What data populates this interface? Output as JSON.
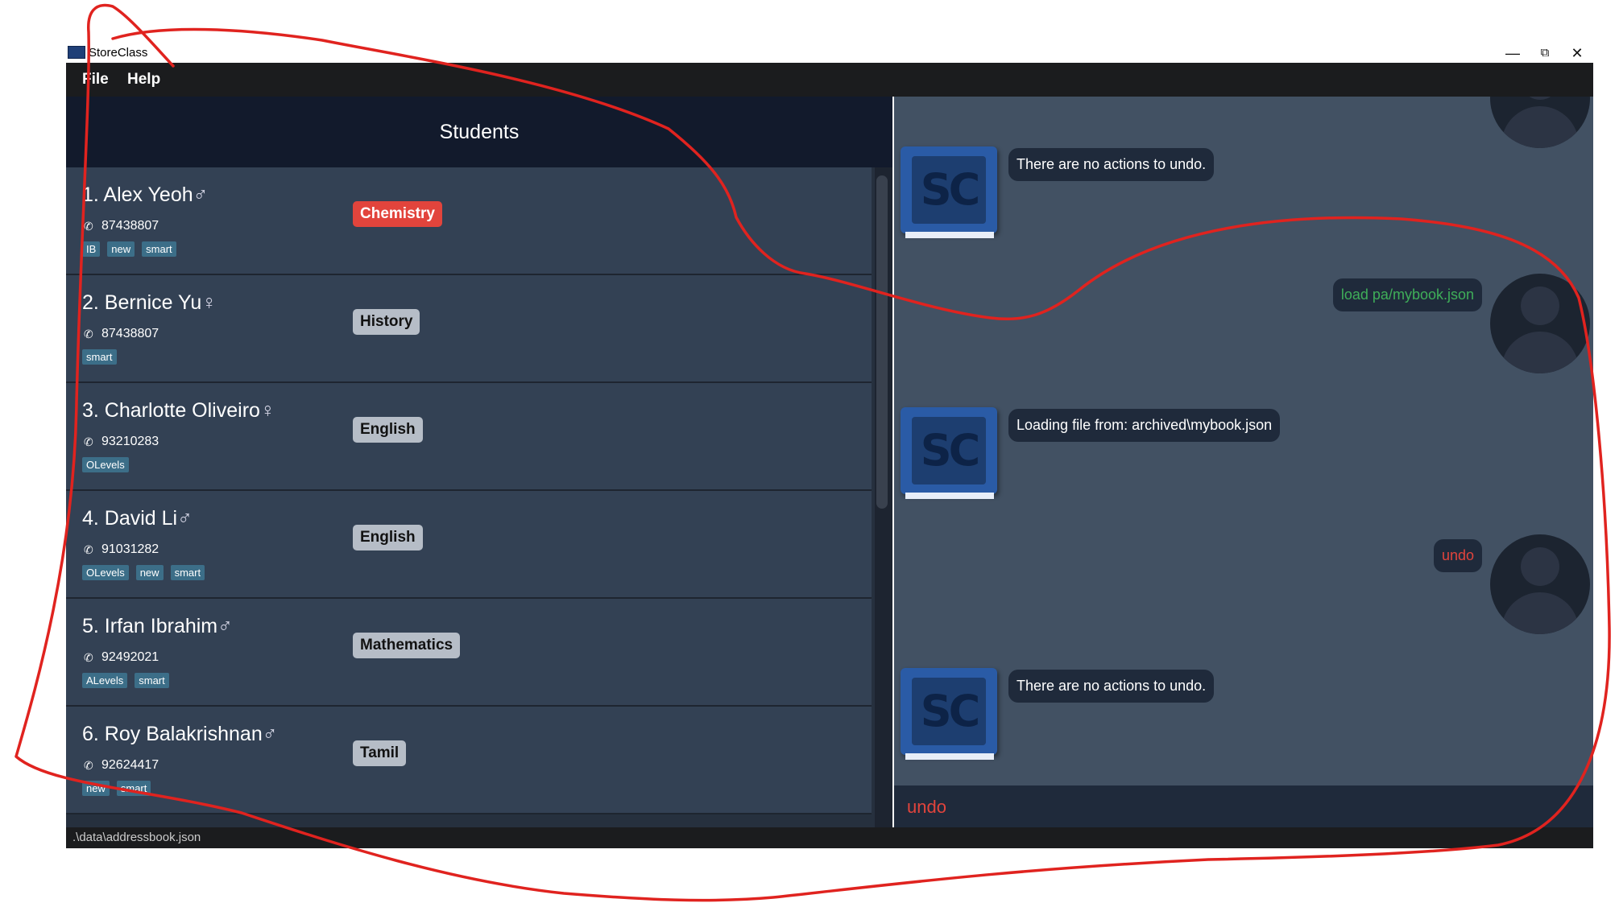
{
  "window": {
    "title": "StoreClass",
    "minimize_glyph": "—",
    "restore_glyph": "⧉",
    "close_glyph": "✕"
  },
  "menu": {
    "file": "File",
    "help": "Help"
  },
  "students_panel": {
    "title": "Students",
    "phone_icon": "phone-icon",
    "students": [
      {
        "name": "1. Alex Yeoh",
        "gender": "♂",
        "phone": "87438807",
        "tags": [
          "IB",
          "new",
          "smart"
        ],
        "subject": "Chemistry",
        "subject_color": "#e2443c"
      },
      {
        "name": "2. Bernice Yu",
        "gender": "♀",
        "phone": "87438807",
        "tags": [
          "smart"
        ],
        "subject": "History",
        "subject_color": "#b6bdc7"
      },
      {
        "name": "3. Charlotte Oliveiro",
        "gender": "♀",
        "phone": "93210283",
        "tags": [
          "OLevels"
        ],
        "subject": "English",
        "subject_color": "#b6bdc7"
      },
      {
        "name": "4. David Li",
        "gender": "♂",
        "phone": "91031282",
        "tags": [
          "OLevels",
          "new",
          "smart"
        ],
        "subject": "English",
        "subject_color": "#b6bdc7"
      },
      {
        "name": "5. Irfan Ibrahim",
        "gender": "♂",
        "phone": "92492021",
        "tags": [
          "ALevels",
          "smart"
        ],
        "subject": "Mathematics",
        "subject_color": "#b6bdc7"
      },
      {
        "name": "6. Roy Balakrishnan",
        "gender": "♂",
        "phone": "92624417",
        "tags": [
          "new",
          "smart"
        ],
        "subject": "Tamil",
        "subject_color": "#b6bdc7"
      }
    ]
  },
  "chat": {
    "bot_logo_text": "SC",
    "messages": [
      {
        "from": "bot",
        "text": "There are no actions to undo."
      },
      {
        "from": "user",
        "text": "load pa/mybook.json",
        "color": "#3fae59"
      },
      {
        "from": "bot",
        "text": "Loading file from: archived\\mybook.json"
      },
      {
        "from": "user",
        "text": "undo",
        "color": "#e2443c"
      },
      {
        "from": "bot",
        "text": "There are no actions to undo."
      }
    ]
  },
  "command_box": {
    "value": "undo"
  },
  "status_bar": {
    "path": ".\\data\\addressbook.json"
  },
  "colors": {
    "menubar": "#1b1c1e",
    "student_card": "#334154",
    "chat_background": "#425163",
    "annotation": "#e0231f"
  }
}
